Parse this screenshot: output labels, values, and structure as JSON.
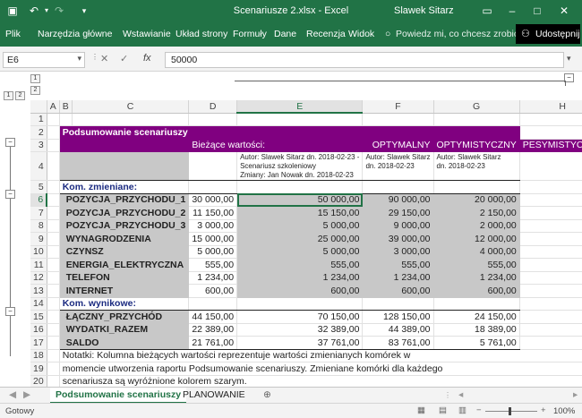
{
  "titlebar": {
    "title": "Scenariusze 2.xlsx  -  Excel",
    "user": "Slawek Sitarz"
  },
  "ribbon": {
    "tabs": [
      "Plik",
      "Narzędzia główne",
      "Wstawianie",
      "Układ strony",
      "Formuły",
      "Dane",
      "Recenzja",
      "Widok"
    ],
    "search": "Powiedz mi, co chcesz zrobić",
    "share": "Udostępnij"
  },
  "formula_bar": {
    "cell": "E6",
    "fx": "fx",
    "value": "50000"
  },
  "outline_levels": {
    "col": [
      "1",
      "2"
    ],
    "row": [
      "1",
      "2"
    ]
  },
  "columns": [
    "A",
    "B",
    "C",
    "D",
    "E",
    "F",
    "G",
    "H"
  ],
  "rows": [
    "1",
    "2",
    "3",
    "4",
    "5",
    "6",
    "7",
    "8",
    "9",
    "10",
    "11",
    "12",
    "13",
    "14",
    "15",
    "16",
    "17",
    "18",
    "19",
    "20"
  ],
  "sheet": {
    "title": "Podsumowanie scenariuszy",
    "current_label": "Bieżące wartości:",
    "scenarios": [
      "OPTYMALNY",
      "OPTYMISTYCZNY",
      "PESYMISTYCZNY"
    ],
    "authors": [
      "Autor: Slawek Sitarz dn. 2018-02-23 - Scenariusz szkoleniowy Zmiany: Jan Nowak dn. 2018-02-23",
      "Autor: Slawek Sitarz dn. 2018-02-23",
      "Autor: Slawek Sitarz dn. 2018-02-23"
    ],
    "author_e_lines": [
      "Autor: Slawek Sitarz dn. 2018-02-23 -",
      "Scenariusz szkoleniowy",
      "Zmiany: Jan Nowak dn. 2018-02-23"
    ],
    "author_f_lines": [
      "Autor: Slawek Sitarz",
      "dn. 2018-02-23"
    ],
    "author_g_lines": [
      "Autor: Slawek Sitarz",
      "dn. 2018-02-23"
    ],
    "changing_label": "Kom. zmieniane:",
    "changing": [
      {
        "name": "POZYCJA_PRZYCHODU_1",
        "current": "30 000,00",
        "v": [
          "50 000,00",
          "90 000,00",
          "20 000,00"
        ]
      },
      {
        "name": "POZYCJA_PRZYCHODU_2",
        "current": "11 150,00",
        "v": [
          "15 150,00",
          "29 150,00",
          "2 150,00"
        ]
      },
      {
        "name": "POZYCJA_PRZYCHODU_3",
        "current": "3 000,00",
        "v": [
          "5 000,00",
          "9 000,00",
          "2 000,00"
        ]
      },
      {
        "name": "WYNAGRODZENIA",
        "current": "15 000,00",
        "v": [
          "25 000,00",
          "39 000,00",
          "12 000,00"
        ]
      },
      {
        "name": "CZYNSZ",
        "current": "5 000,00",
        "v": [
          "5 000,00",
          "3 000,00",
          "4 000,00"
        ]
      },
      {
        "name": "ENERGIA_ELEKTRYCZNA",
        "current": "555,00",
        "v": [
          "555,00",
          "555,00",
          "555,00"
        ]
      },
      {
        "name": "TELEFON",
        "current": "1 234,00",
        "v": [
          "1 234,00",
          "1 234,00",
          "1 234,00"
        ]
      },
      {
        "name": "INTERNET",
        "current": "600,00",
        "v": [
          "600,00",
          "600,00",
          "600,00"
        ]
      }
    ],
    "result_label": "Kom. wynikowe:",
    "results": [
      {
        "name": "ŁĄCZNY_PRZYCHÓD",
        "current": "44 150,00",
        "v": [
          "70 150,00",
          "128 150,00",
          "24 150,00"
        ]
      },
      {
        "name": "WYDATKI_RAZEM",
        "current": "22 389,00",
        "v": [
          "32 389,00",
          "44 389,00",
          "18 389,00"
        ]
      },
      {
        "name": "SALDO",
        "current": "21 761,00",
        "v": [
          "37 761,00",
          "83 761,00",
          "5 761,00"
        ]
      }
    ],
    "notes": [
      "Notatki: Kolumna bieżących wartości reprezentuje wartości zmienianych komórek w",
      "momencie utworzenia raportu Podsumowanie scenariuszy. Zmieniane komórki dla każdego",
      "scenariusza są wyróżnione kolorem szarym."
    ]
  },
  "sheet_tabs": [
    "Podsumowanie scenariuszy",
    "PLANOWANIE"
  ],
  "status": {
    "ready": "Gotowy",
    "zoom": "100%"
  },
  "colors": {
    "excel_green": "#217346",
    "header_purple": "#800080",
    "scenario_gray": "#c8c8c8"
  }
}
